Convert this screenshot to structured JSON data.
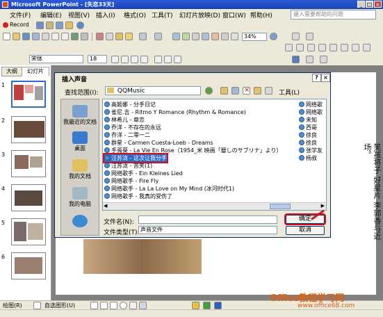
{
  "window": {
    "title": "Microsoft PowerPoint - [失恋33天]"
  },
  "menu": {
    "items": [
      "文件(F)",
      "编辑(E)",
      "视图(V)",
      "插入(I)",
      "格式(O)",
      "工具(T)",
      "幻灯片放映(D)",
      "窗口(W)",
      "帮助(H)"
    ],
    "help_placeholder": "键入需要帮助的问题"
  },
  "toolbar": {
    "record_label": "Record",
    "font_name": "宋体",
    "font_size": "18",
    "zoom": "34%"
  },
  "leftpane": {
    "tabs": [
      "大纲",
      "幻灯片"
    ],
    "slide_numbers": [
      "1",
      "2",
      "3",
      "4",
      "5",
      "6"
    ]
  },
  "dialog": {
    "title": "插入声音",
    "lookin_label": "查找范围(I):",
    "lookin_value": "QQMusic",
    "tools_label": "工具(L)",
    "places": [
      "我最近的文档",
      "桌面",
      "我的文档",
      "我的电脑",
      ""
    ],
    "files": [
      "高姬娜 - 分手日记",
      "雀尼.吉 - Ritmo Y Romance (Rhythm & Romance)",
      "林希儿 - 章恋",
      "乔洋 - 不存在的永远",
      "乔洋 - 二零一二",
      "群星 - Carmen Cuesta-Loeb - Dreams",
      "手焉葵 - La Vie En Rose（1954_米 映画「暦しのサブリナ」より）",
      "汪苏泷 - 这次让我分手",
      "汪苏泷 - 苦笑(1)",
      "网络歌手 - Ein Kleines Lied",
      "网络歌手 - Fire Fly",
      "网络歌手 - La La Love on My Mind (冰河时代1)",
      "网络歌手 - 我真的受伤了"
    ],
    "right_files": [
      "网络歌",
      "网络歌",
      "未知",
      "西哥",
      "徐良",
      "徐良",
      "张学友",
      "杨叔"
    ],
    "filename_label": "文件名(N):",
    "filename_value": "",
    "filetype_label": "文件类型(T):",
    "filetype_value": "声音文件",
    "ok_label": "确定",
    "cancel_label": "取消"
  },
  "slide_text": "笑孩将子 好星片 李郭香与近 场。",
  "statusbar": {
    "draw_label": "绘图(R)",
    "autoshape_label": "自选图形(U)"
  },
  "watermark": {
    "text": "Office教程学习网",
    "url": "www.office68.com"
  }
}
